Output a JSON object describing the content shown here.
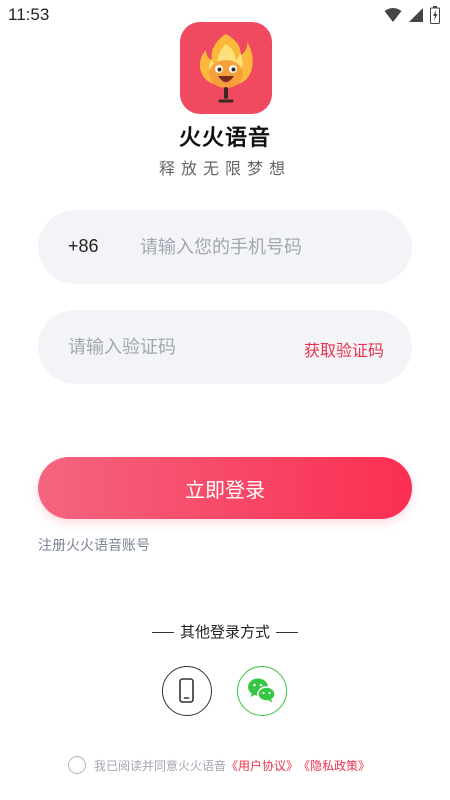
{
  "status_bar": {
    "time": "11:53"
  },
  "app": {
    "name": "火火语音",
    "slogan": "释放无限梦想"
  },
  "phone_field": {
    "country_code": "+86",
    "placeholder": "请输入您的手机号码"
  },
  "code_field": {
    "placeholder": "请输入验证码",
    "get_code_label": "获取验证码"
  },
  "login_button": {
    "label": "立即登录"
  },
  "register_link": {
    "label": "注册火火语音账号"
  },
  "other_login": {
    "title": "其他登录方式"
  },
  "agreement": {
    "prefix": "我已阅读并同意火火语音",
    "user_agreement": "《用户协议》",
    "privacy_policy": "《隐私政策》"
  },
  "colors": {
    "accent": "#f5365c",
    "logo_background": "#ef4a60",
    "wechat": "#35c742",
    "field_background": "#f3f4f7"
  },
  "icons": [
    "wifi-icon",
    "signal-icon",
    "battery-icon",
    "app-logo-icon",
    "phone-icon",
    "wechat-icon",
    "radio-icon"
  ]
}
